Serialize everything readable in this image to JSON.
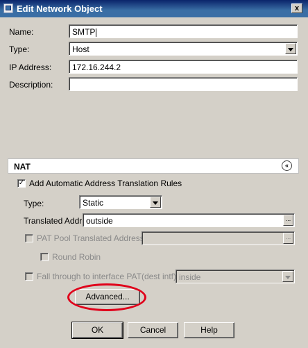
{
  "window": {
    "title": "Edit Network Object",
    "close_symbol": "x",
    "app_icon": "network-object-icon",
    "close_icon": "close-icon"
  },
  "form": {
    "name_label": "Name:",
    "name_value": "SMTP",
    "type_label": "Type:",
    "type_value": "Host",
    "ip_label": "IP Address:",
    "ip_value": "172.16.244.2",
    "desc_label": "Description:",
    "desc_value": ""
  },
  "nat": {
    "section_title": "NAT",
    "collapse_symbol": "«",
    "collapse_icon": "collapse-up-icon",
    "auto_rules_label": "Add Automatic Address Translation Rules",
    "auto_rules_checked": true,
    "check_mark": "✓",
    "type_label": "Type:",
    "type_value": "Static",
    "translated_label": "Translated Addr:",
    "translated_value": "outside",
    "browse_symbol": "...",
    "pat_pool_label": "PAT Pool Translated Address:",
    "pat_pool_value": "",
    "round_robin_label": "Round Robin",
    "fallthrough_label": "Fall through to interface PAT(dest intf):",
    "fallthrough_value": "inside",
    "advanced_label": "Advanced..."
  },
  "buttons": {
    "ok": "OK",
    "cancel": "Cancel",
    "help": "Help"
  },
  "colors": {
    "titlebar": "#0a246a",
    "dialog_bg": "#d4d0c8",
    "highlight": "#e0001a"
  }
}
